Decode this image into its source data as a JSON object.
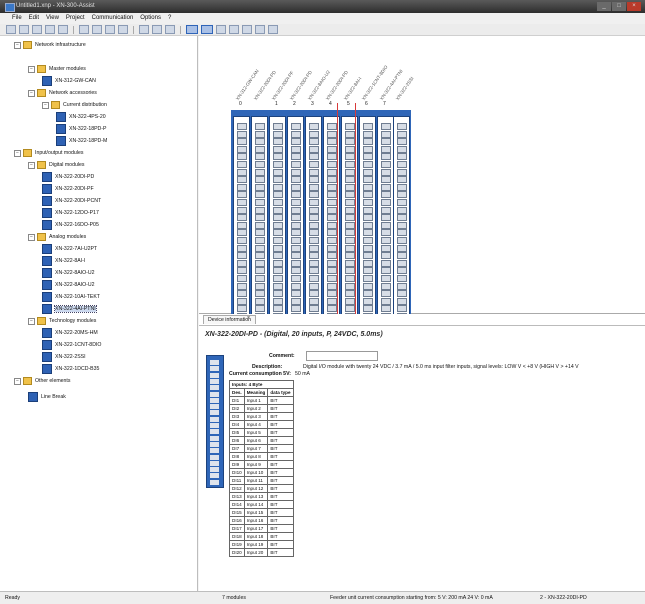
{
  "window": {
    "title": "Untitled1.xnp - XN-300-Assist"
  },
  "menu": [
    "File",
    "Edit",
    "View",
    "Project",
    "Communication",
    "Options",
    "?"
  ],
  "tree": [
    {
      "label": "Network infrastructure",
      "kind": "folder",
      "level": 0
    },
    {
      "label": "Master modules",
      "kind": "folder",
      "level": 1
    },
    {
      "label": "XN-312-GW-CAN",
      "kind": "module",
      "level": 2
    },
    {
      "label": "Network accessories",
      "kind": "folder",
      "level": 1
    },
    {
      "label": "Current distribution",
      "kind": "folder",
      "level": 2
    },
    {
      "label": "XN-322-4PS-20",
      "kind": "module",
      "level": 3
    },
    {
      "label": "XN-322-18PD-P",
      "kind": "module",
      "level": 3
    },
    {
      "label": "XN-322-18PD-M",
      "kind": "module",
      "level": 3
    },
    {
      "label": "Input/output modules",
      "kind": "folder",
      "level": 0
    },
    {
      "label": "Digital modules",
      "kind": "folder",
      "level": 1
    },
    {
      "label": "XN-322-20DI-PD",
      "kind": "module",
      "level": 2
    },
    {
      "label": "XN-322-20DI-PF",
      "kind": "module",
      "level": 2
    },
    {
      "label": "XN-322-20DI-PCNT",
      "kind": "module",
      "level": 2
    },
    {
      "label": "XN-322-12DO-P17",
      "kind": "module",
      "level": 2
    },
    {
      "label": "XN-322-16DO-P05",
      "kind": "module",
      "level": 2
    },
    {
      "label": "Analog modules",
      "kind": "folder",
      "level": 1
    },
    {
      "label": "XN-322-7AI-U2PT",
      "kind": "module",
      "level": 2
    },
    {
      "label": "XN-322-8AI-I",
      "kind": "module",
      "level": 2
    },
    {
      "label": "XN-322-8AIO-U2",
      "kind": "module",
      "level": 2
    },
    {
      "label": "XN-322-8AIO-U2",
      "kind": "module",
      "level": 2
    },
    {
      "label": "XN-322-10AI-TEKT",
      "kind": "module",
      "level": 2
    },
    {
      "label": "XN-322-4AI-PTNI",
      "kind": "module",
      "level": 2
    },
    {
      "label": "Technology modules",
      "kind": "folder",
      "level": 1
    },
    {
      "label": "XN-322-20MS-HM",
      "kind": "module",
      "level": 2
    },
    {
      "label": "XN-322-1CNT-8DIO",
      "kind": "module",
      "level": 2
    },
    {
      "label": "XN-322-2SSI",
      "kind": "module",
      "level": 2
    },
    {
      "label": "XN-322-1DCD-B35",
      "kind": "module",
      "level": 2
    },
    {
      "label": "Other elements",
      "kind": "folder",
      "level": 0
    },
    {
      "label": "Line Break",
      "kind": "linebreak",
      "level": 1
    }
  ],
  "canvas": {
    "slot_numbers": [
      "0",
      "1",
      "2",
      "3",
      "4",
      "5",
      "6",
      "7"
    ],
    "slot_labels": [
      "XN-312-GW-CAN",
      "XN-322-20DI-PD",
      "XN-322-20DI-PF",
      "XN-322-20DI-PD",
      "XN-322-8AIO-U2",
      "XN-322-20DI-PD",
      "XN-322-8AI-I",
      "XN-322-1CNT-8DIO",
      "XN-322-4AI-PTNI",
      "XN-322-2SSI"
    ]
  },
  "panel": {
    "tab_label": "Device information",
    "tab_close": "×",
    "heading": "XN-322-20DI-PD - (Digital, 20 inputs, P, 24VDC, 5.0ms)",
    "comment_label": "Comment:",
    "description_label": "Description:",
    "description_value": "Digital I/O module with twenty 24 VDC / 3.7 mA / 5.0 ms input filter inputs, signal levels: LOW V < +8 V (HIGH V > +14 V",
    "consumption_label": "Current consumption 5V:",
    "consumption_value": "50 mA",
    "table_title": "Inputs: 4 Byte",
    "columns": [
      "Des.",
      "Meaning",
      "data type"
    ],
    "rows": [
      [
        "DI1",
        "Input 1",
        "BIT"
      ],
      [
        "DI2",
        "Input 2",
        "BIT"
      ],
      [
        "DI3",
        "Input 3",
        "BIT"
      ],
      [
        "DI4",
        "Input 4",
        "BIT"
      ],
      [
        "DI5",
        "Input 5",
        "BIT"
      ],
      [
        "DI6",
        "Input 6",
        "BIT"
      ],
      [
        "DI7",
        "Input 7",
        "BIT"
      ],
      [
        "DI8",
        "Input 8",
        "BIT"
      ],
      [
        "DI9",
        "Input 9",
        "BIT"
      ],
      [
        "DI10",
        "Input 10",
        "BIT"
      ],
      [
        "DI11",
        "Input 11",
        "BIT"
      ],
      [
        "DI12",
        "Input 12",
        "BIT"
      ],
      [
        "DI13",
        "Input 13",
        "BIT"
      ],
      [
        "DI14",
        "Input 14",
        "BIT"
      ],
      [
        "DI15",
        "Input 15",
        "BIT"
      ],
      [
        "DI16",
        "Input 16",
        "BIT"
      ],
      [
        "DI17",
        "Input 17",
        "BIT"
      ],
      [
        "DI18",
        "Input 18",
        "BIT"
      ],
      [
        "DI19",
        "Input 19",
        "BIT"
      ],
      [
        "DI20",
        "Input 20",
        "BIT"
      ]
    ]
  },
  "status": {
    "left": "Ready",
    "modules": "7 modules",
    "feeder": "Feeder unit current consumption starting from: 5 V: 200 mA 24 V: 0 mA",
    "right": "2 - XN-322-20DI-PD"
  },
  "colors": {
    "rack": "#2f66b8",
    "selection": "#d83a3a",
    "folder": "#f0c24a"
  }
}
